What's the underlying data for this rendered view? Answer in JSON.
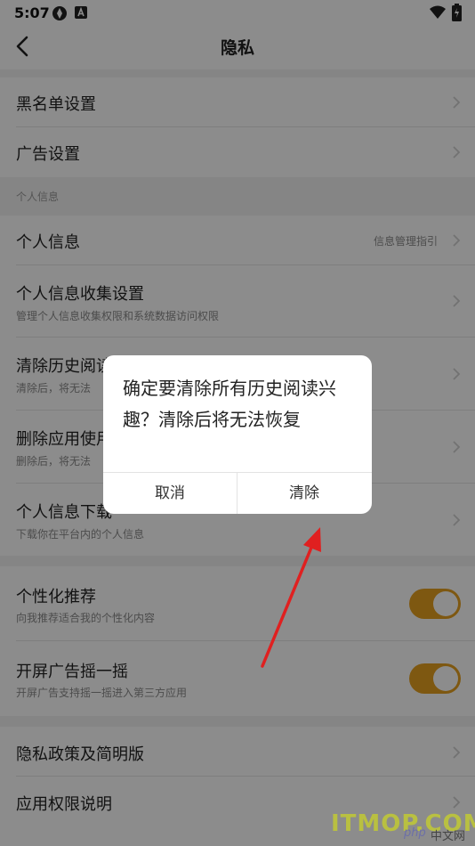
{
  "status_bar": {
    "time": "5:07"
  },
  "header": {
    "title": "隐私"
  },
  "group1": {
    "items": [
      {
        "title": "黑名单设置"
      },
      {
        "title": "广告设置"
      }
    ]
  },
  "personal": {
    "section_label": "个人信息",
    "items": [
      {
        "title": "个人信息",
        "right": "信息管理指引"
      },
      {
        "title": "个人信息收集设置",
        "subtitle": "管理个人信息收集权限和系统数据访问权限"
      },
      {
        "title": "清除历史阅读",
        "subtitle": "清除后，将无法"
      },
      {
        "title": "删除应用使用",
        "subtitle": "删除后，将无法"
      },
      {
        "title": "个人信息下载",
        "subtitle": "下载你在平台内的个人信息"
      }
    ]
  },
  "recommend": {
    "items": [
      {
        "title": "个性化推荐",
        "subtitle": "向我推荐适合我的个性化内容",
        "enabled": true
      },
      {
        "title": "开屏广告摇一摇",
        "subtitle": "开屏广告支持摇一摇进入第三方应用",
        "enabled": true
      }
    ]
  },
  "group4": {
    "items": [
      {
        "title": "隐私政策及简明版"
      },
      {
        "title": "应用权限说明"
      }
    ]
  },
  "dialog": {
    "message": "确定要清除所有历史阅读兴趣？清除后将无法恢复",
    "cancel_label": "取消",
    "confirm_label": "清除"
  },
  "watermark": {
    "main": "ITMOP.COM",
    "php": "php",
    "cn": "中文网"
  },
  "colors": {
    "toggle_on": "#e6a020",
    "annotation_arrow": "#e02020"
  }
}
